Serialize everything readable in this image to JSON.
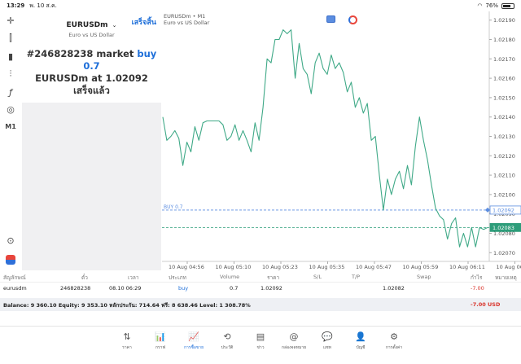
{
  "status_bar": {
    "time": "13:29",
    "date": "พ. 10 ส.ค.",
    "battery": "76%",
    "battery_level": 0.76
  },
  "order_panel": {
    "symbol": "EURUSDm",
    "symbol_desc": "Euro vs US Dollar",
    "done_label": "เสร็จสิ้น",
    "result_line1_prefix": "#246828238 market ",
    "result_line1_action": "buy 0.7",
    "result_line2_prefix": "EURUSDm at ",
    "result_line2_price": "1.02092",
    "result_line3": "เสร็จแล้ว"
  },
  "left_toolbar": {
    "timeframe": "M1"
  },
  "chart_header": {
    "title": "EURUSDm • M1",
    "subtitle": "Euro vs US Dollar"
  },
  "chart_data": {
    "type": "line",
    "title": "",
    "y_ticks": [
      "1.02190",
      "1.02180",
      "1.02170",
      "1.02160",
      "1.02150",
      "1.02140",
      "1.02130",
      "1.02120",
      "1.02110",
      "1.02100",
      "1.02090",
      "1.02080",
      "1.02070"
    ],
    "x_ticks": [
      "10 Aug 04:56",
      "10 Aug 05:10",
      "10 Aug 05:23",
      "10 Aug 05:35",
      "10 Aug 05:47",
      "10 Aug 05:59",
      "10 Aug 06:11",
      "10 Aug 06:23"
    ],
    "ylim": [
      1.020655,
      1.021945
    ],
    "series": [
      {
        "values": [
          1.0214,
          1.02128,
          1.0213,
          1.02133,
          1.02129,
          1.02115,
          1.02127,
          1.02122,
          1.02135,
          1.02128,
          1.02137,
          1.02138,
          1.02138,
          1.02138,
          1.02138,
          1.02136,
          1.02128,
          1.0213,
          1.02136,
          1.02128,
          1.02133,
          1.02128,
          1.02122,
          1.02137,
          1.02128,
          1.02145,
          1.0217,
          1.02168,
          1.0218,
          1.0218,
          1.02185,
          1.02183,
          1.02185,
          1.0216,
          1.02178,
          1.02165,
          1.02162,
          1.02152,
          1.02168,
          1.02173,
          1.02165,
          1.02162,
          1.02172,
          1.02165,
          1.02168,
          1.02163,
          1.02153,
          1.02158,
          1.02145,
          1.0215,
          1.02142,
          1.02147,
          1.02128,
          1.0213,
          1.0211,
          1.02092,
          1.02108,
          1.021,
          1.02108,
          1.02112,
          1.02103,
          1.02115,
          1.02105,
          1.02125,
          1.0214,
          1.02128,
          1.02118,
          1.02105,
          1.02093,
          1.02089,
          1.02087,
          1.02077,
          1.02085,
          1.02088,
          1.02073,
          1.0208,
          1.02073,
          1.02083,
          1.02073,
          1.02083,
          1.02082,
          1.02083
        ]
      }
    ],
    "levels": [
      {
        "label": "BUY 0.7",
        "value": 1.02092,
        "value_label": "1.02092",
        "color": "#5b8de0"
      },
      {
        "label": "",
        "value": 1.02083,
        "value_label": "1.02083",
        "color": "#2e9d7a"
      }
    ],
    "line_color": "#3fa987"
  },
  "positions": {
    "headers": [
      "สัญลักษณ์",
      "ตั๋ว",
      "เวลา",
      "ประเภท",
      "Volume",
      "ราคา",
      "S/L",
      "T/P",
      "Swap",
      "กำไร",
      "หมายเหตุ"
    ],
    "row": {
      "symbol": "eurusdm",
      "ticket": "246828238",
      "time": "08.10 06:29",
      "type": "buy",
      "volume": "0.7",
      "price": "1.02092",
      "current": "1.02082",
      "profit": "-7.00"
    },
    "balance_text": "Balance: 9 360.10 Equity: 9 353.10 หลักประกัน: 714.64 ฟรี: 8 638.46 Level: 1 308.78%",
    "balance_profit": "-7.00",
    "balance_currency": "USD"
  },
  "tabs": [
    {
      "icon": "⇅",
      "label": "ราคา"
    },
    {
      "icon": "📊",
      "label": "กราฟ"
    },
    {
      "icon": "📈",
      "label": "การซื้อขาย"
    },
    {
      "icon": "⟲",
      "label": "ประวัติ"
    },
    {
      "icon": "▤",
      "label": "ข่าว"
    },
    {
      "icon": "@",
      "label": "กล่องจดหมาย"
    },
    {
      "icon": "💬",
      "label": "แชท"
    },
    {
      "icon": "👤",
      "label": "บัญชี"
    },
    {
      "icon": "⚙",
      "label": "การตั้งค่า"
    }
  ],
  "active_tab_index": 2
}
